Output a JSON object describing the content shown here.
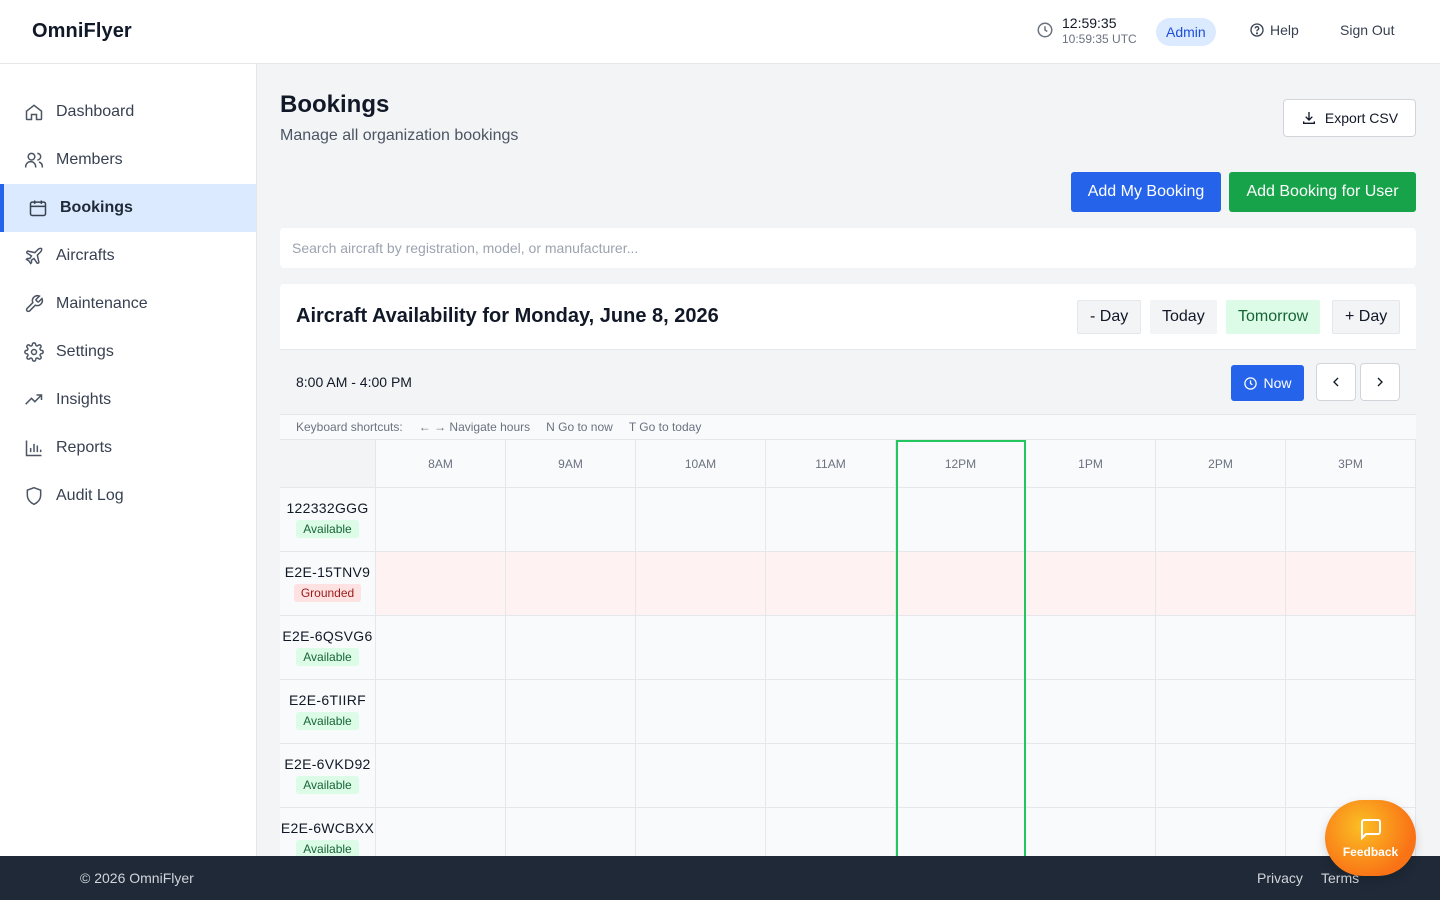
{
  "app": {
    "brand": "OmniFlyer"
  },
  "header": {
    "local_time": "12:59:35",
    "utc_time": "10:59:35 UTC",
    "role": "Admin",
    "help": "Help",
    "sign_out": "Sign Out"
  },
  "sidebar": {
    "items": [
      {
        "label": "Dashboard",
        "icon": "home-icon"
      },
      {
        "label": "Members",
        "icon": "users-icon"
      },
      {
        "label": "Bookings",
        "icon": "calendar-icon",
        "active": true
      },
      {
        "label": "Aircrafts",
        "icon": "plane-icon"
      },
      {
        "label": "Maintenance",
        "icon": "wrench-icon"
      },
      {
        "label": "Settings",
        "icon": "gear-icon"
      },
      {
        "label": "Insights",
        "icon": "trending-up-icon"
      },
      {
        "label": "Reports",
        "icon": "bar-chart-icon"
      },
      {
        "label": "Audit Log",
        "icon": "shield-icon"
      }
    ]
  },
  "page": {
    "title": "Bookings",
    "subtitle": "Manage all organization bookings",
    "export": "Export CSV",
    "add_my_booking": "Add My Booking",
    "add_booking_user": "Add Booking for User",
    "search_placeholder": "Search aircraft by registration, model, or manufacturer..."
  },
  "availability": {
    "title": "Aircraft Availability for Monday, June 8, 2026",
    "day_buttons": {
      "prev": "- Day",
      "today": "Today",
      "tomorrow": "Tomorrow",
      "next": "+ Day"
    },
    "time_range": "8:00 AM - 4:00 PM",
    "now": "Now",
    "shortcuts": {
      "label": "Keyboard shortcuts:",
      "items": [
        "← → Navigate hours",
        "N Go to now",
        "T Go to today"
      ]
    },
    "hours": [
      "8AM",
      "9AM",
      "10AM",
      "11AM",
      "12PM",
      "1PM",
      "2PM",
      "3PM"
    ],
    "current_hour": "12PM",
    "aircraft": [
      {
        "reg": "122332GGG",
        "status": "Available"
      },
      {
        "reg": "E2E-15TNV9",
        "status": "Grounded"
      },
      {
        "reg": "E2E-6QSVG6",
        "status": "Available"
      },
      {
        "reg": "E2E-6TIIRF",
        "status": "Available"
      },
      {
        "reg": "E2E-6VKD92",
        "status": "Available"
      },
      {
        "reg": "E2E-6WCBXX",
        "status": "Available"
      }
    ]
  },
  "footer": {
    "copyright": "© 2026 OmniFlyer",
    "privacy": "Privacy",
    "terms": "Terms"
  },
  "feedback": {
    "label": "Feedback"
  },
  "colors": {
    "primary": "#2563eb",
    "success": "#16a34a",
    "footer": "#1f2937",
    "now_outline": "#22c55e"
  }
}
